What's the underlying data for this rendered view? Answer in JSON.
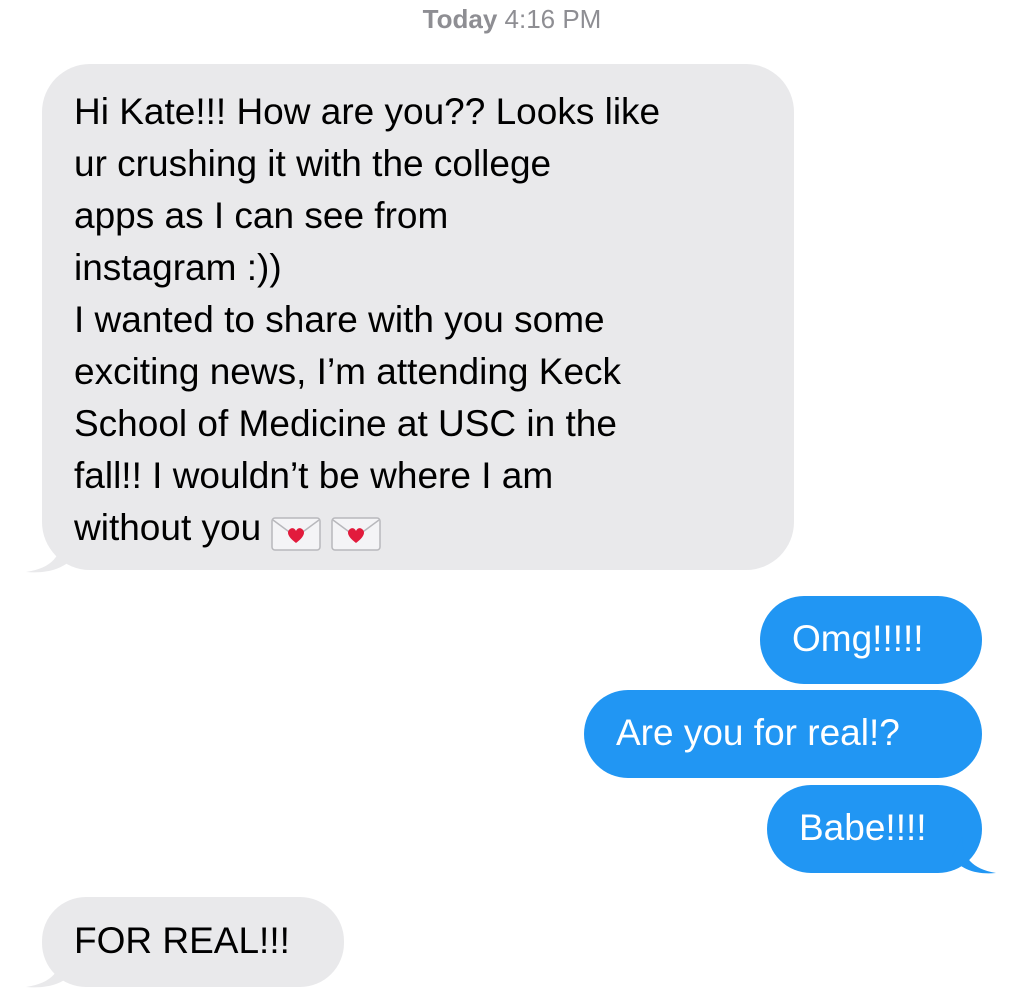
{
  "thread": {
    "timestamp_day": "Today",
    "timestamp_time": "4:16 PM",
    "messages": [
      {
        "direction": "incoming",
        "text": "Hi Kate!!! How are you?? Looks like\nur crushing it with the college\napps as I can see from\ninstagram :))\nI wanted to share with you some\nexciting news, I’m attending Keck\nSchool of Medicine at USC in the\nfall!! I wouldn’t be where I am\nwithout you",
        "emoji": [
          "love-letter-icon",
          "love-letter-icon"
        ]
      },
      {
        "direction": "outgoing",
        "text": "Omg!!!!!"
      },
      {
        "direction": "outgoing",
        "text": "Are you for real!?"
      },
      {
        "direction": "outgoing",
        "text": "Babe!!!!"
      },
      {
        "direction": "incoming",
        "text": "FOR REAL!!!"
      }
    ]
  },
  "colors": {
    "incoming_bubble": "#e9e9eb",
    "outgoing_bubble": "#2196f3",
    "timestamp_text": "#8e8e93"
  }
}
